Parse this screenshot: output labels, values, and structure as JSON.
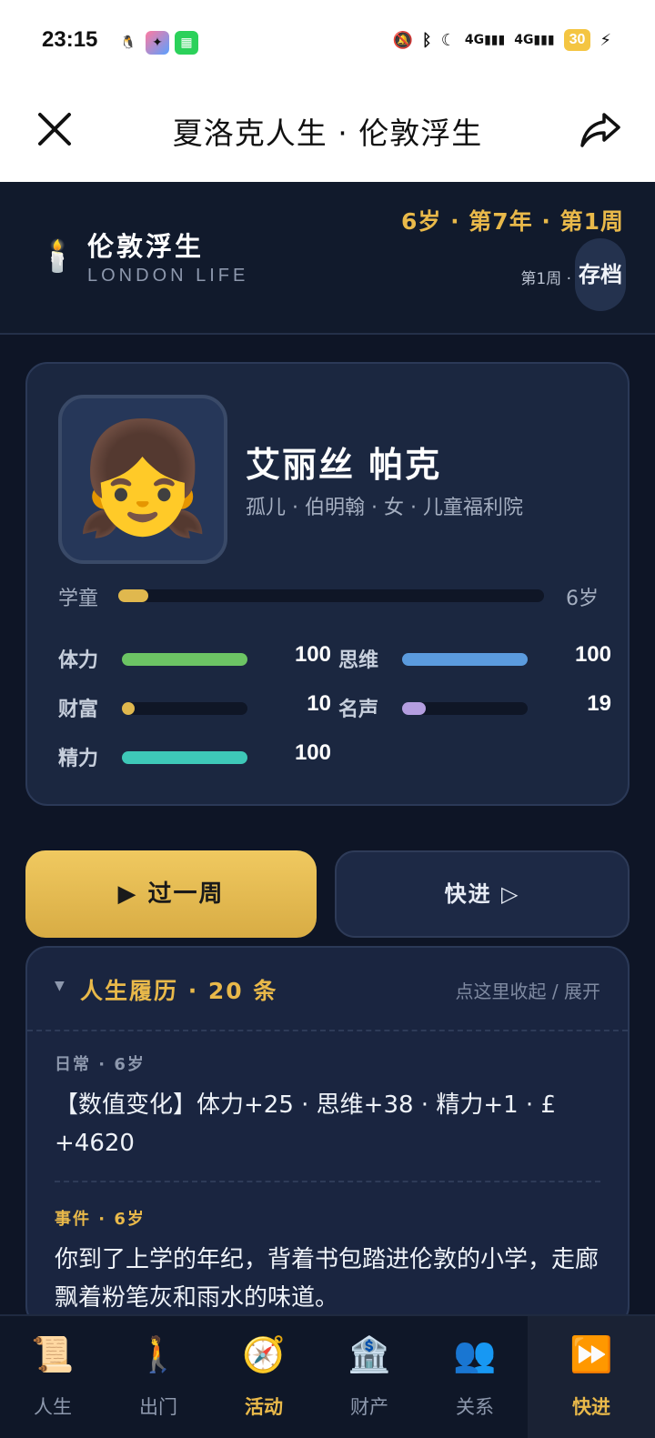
{
  "status_bar": {
    "time": "23:15",
    "network": "4G",
    "battery": "30",
    "battery_color": "#f4c542"
  },
  "title_bar": {
    "title": "夏洛克人生 · 伦敦浮生",
    "close_icon": "close-icon",
    "share_icon": "share-icon"
  },
  "header": {
    "brand_name": "伦敦浮生",
    "brand_sub": "LONDON LIFE",
    "age_line": "6岁 · 第7年 · 第1周",
    "week_small": "第1周 ·",
    "save_label": "存档",
    "accent": "#e9b94a"
  },
  "character": {
    "avatar_emoji": "👧",
    "name": "艾丽丝 帕克",
    "meta": "孤儿 · 伯明翰 · 女 · 儿童福利院",
    "stage": {
      "label": "学童",
      "age": "6岁",
      "progress": 0.07
    },
    "stats": [
      {
        "label": "体力",
        "value": "100",
        "fill": 1.0,
        "color": "#6cc464"
      },
      {
        "label": "思维",
        "value": "100",
        "fill": 1.0,
        "color": "#5b9bde"
      },
      {
        "label": "财富",
        "value": "10",
        "fill": 0.1,
        "color": "#e0b84e"
      },
      {
        "label": "名声",
        "value": "19",
        "fill": 0.19,
        "color": "#b49ee0"
      },
      {
        "label": "精力",
        "value": "100",
        "fill": 1.0,
        "color": "#3ec8b8"
      }
    ]
  },
  "actions": {
    "next_week": "▶ 过一周",
    "fast_forward": "快进 ▷"
  },
  "history": {
    "caret": "▼",
    "title": "人生履历 · 20 条",
    "toggle": "点这里收起 / 展开",
    "entries": [
      {
        "tag": "日常 · 6岁",
        "tag_color": "#8d98ad",
        "text": "【数值变化】体力+25 · 思维+38 · 精力+1 · £ +4620"
      },
      {
        "tag": "事件 · 6岁",
        "tag_color": "#e9b94a",
        "text": "你到了上学的年纪，背着书包踏进伦敦的小学，走廊飘着粉笔灰和雨水的味道。"
      }
    ]
  },
  "nav": [
    {
      "icon": "📜",
      "icon_name": "scroll-icon",
      "label": "人生",
      "active": false
    },
    {
      "icon": "🚶",
      "icon_name": "walking-icon",
      "label": "出门",
      "active": false
    },
    {
      "icon": "🧭",
      "icon_name": "compass-icon",
      "label": "活动",
      "active": false,
      "highlight": true
    },
    {
      "icon": "🏦",
      "icon_name": "bank-icon",
      "label": "财产",
      "active": false
    },
    {
      "icon": "👥",
      "icon_name": "people-icon",
      "label": "关系",
      "active": false
    },
    {
      "icon": "⏩",
      "icon_name": "fast-forward-icon",
      "label": "快进",
      "active": true,
      "highlight": true
    }
  ]
}
